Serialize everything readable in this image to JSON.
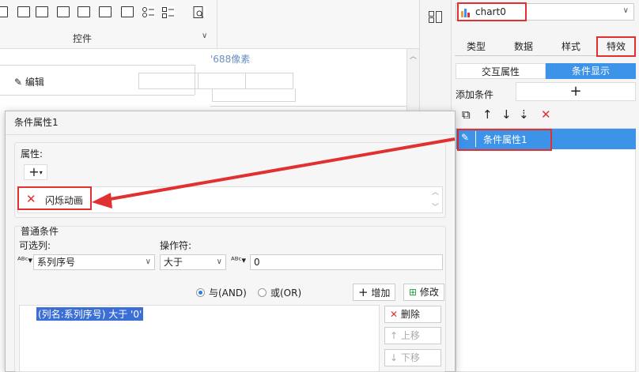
{
  "toolbar": {
    "label": "控件"
  },
  "canvas": {
    "pixel_label": "'688像素",
    "edit_label": "编辑"
  },
  "right_panel": {
    "chart_name": "chart0",
    "tabs": [
      "类型",
      "数据",
      "样式",
      "特效"
    ],
    "segments": {
      "interact": "交互属性",
      "condition": "条件显示"
    },
    "add_condition_label": "添加条件",
    "add_symbol": "+",
    "condition_item": "条件属性1"
  },
  "dialog": {
    "title": "条件属性1",
    "property_label": "属性:",
    "property_item": "闪烁动画",
    "common_label": "普通条件",
    "column_label": "可选列:",
    "column_value": "系列序号",
    "operator_label": "操作符:",
    "operator_value": "大于",
    "value": "0",
    "radio_and": "与(AND)",
    "radio_or": "或(OR)",
    "add_btn": "增加",
    "modify_btn": "修改",
    "expression": "(列名:系列序号) 大于 '0'",
    "delete_btn": "删除",
    "up_btn": "上移",
    "down_btn": "下移"
  },
  "colors": {
    "accent": "#3d93e8",
    "highlight": "#e03030"
  }
}
